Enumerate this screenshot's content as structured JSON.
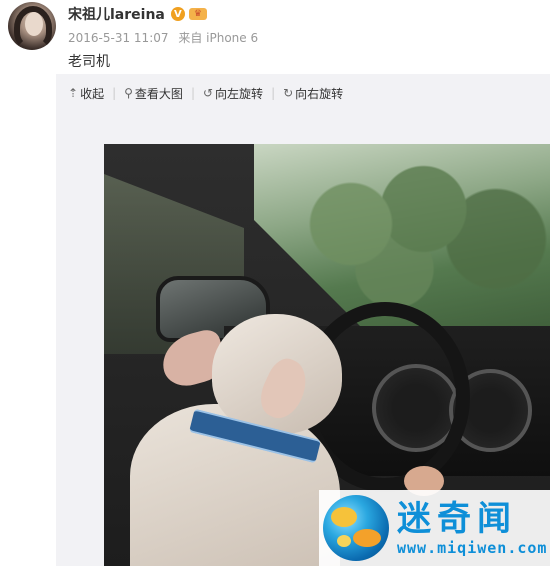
{
  "post": {
    "username": "宋祖儿lareina",
    "verified_badge": "V",
    "date": "2016-5-31 11:07",
    "source": "来自 iPhone 6",
    "text": "老司机"
  },
  "toolbar": {
    "items": [
      {
        "icon": "collapse-up-icon",
        "glyph": "⇡",
        "label": "收起"
      },
      {
        "icon": "magnifier-icon",
        "glyph": "⚲",
        "label": "查看大图"
      },
      {
        "icon": "rotate-left-icon",
        "glyph": "↺",
        "label": "向左旋转"
      },
      {
        "icon": "rotate-right-icon",
        "glyph": "↻",
        "label": "向右旋转"
      }
    ]
  },
  "watermark": {
    "title": "迷奇闻",
    "url": "www.miqiwen.com"
  },
  "colors": {
    "watermark_blue": "#0e8fd8",
    "panel_bg": "#f2f2f5",
    "meta_gray": "#999999"
  }
}
